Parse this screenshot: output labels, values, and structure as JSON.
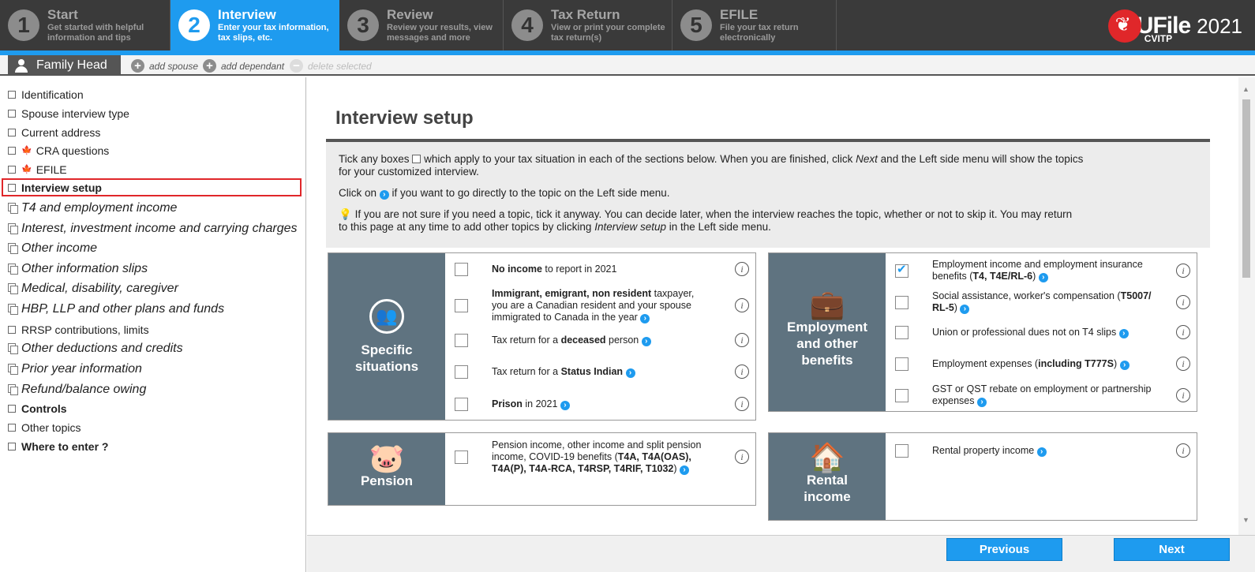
{
  "steps": [
    {
      "num": "1",
      "title": "Start",
      "sub1": "Get started with helpful",
      "sub2": "information and tips"
    },
    {
      "num": "2",
      "title": "Interview",
      "sub1": "Enter your tax information,",
      "sub2": "tax slips, etc."
    },
    {
      "num": "3",
      "title": "Review",
      "sub1": "Review your results, view",
      "sub2": "messages and more"
    },
    {
      "num": "4",
      "title": "Tax Return",
      "sub1": "View or print your complete",
      "sub2": "tax return(s)"
    },
    {
      "num": "5",
      "title": "EFILE",
      "sub1": "File your tax return",
      "sub2": "electronically"
    }
  ],
  "logo": {
    "brand": "UFile",
    "sub": "CVITP",
    "year": "2021"
  },
  "family": {
    "tab": "Family Head",
    "add_spouse": "add spouse",
    "add_dependant": "add dependant",
    "delete_selected": "delete selected"
  },
  "sidebar": [
    "Identification",
    "Spouse interview type",
    "Current address",
    "CRA questions",
    "EFILE",
    "Interview setup",
    "T4 and employment income",
    "Interest, investment income and carrying charges",
    "Other income",
    "Other information slips",
    "Medical, disability, caregiver",
    "HBP, LLP and other plans and funds",
    "RRSP contributions, limits",
    "Other deductions and credits",
    "Prior year information",
    "Refund/balance owing",
    "Controls",
    "Other topics",
    "Where to enter ?"
  ],
  "main": {
    "title": "Interview setup",
    "intro": {
      "p1a": "Tick any boxes",
      "p1b": "which apply to your tax situation in each of the sections below. When you are finished, click",
      "p1c": "Next",
      "p1d": "and the Left side menu will show the topics",
      "p1e": "for your customized interview.",
      "p2a": "Click on",
      "p2b": "if you want to go directly to the topic on the Left side menu.",
      "p3a": "If you are not sure if you need a topic, tick it anyway. You can decide later, when the interview reaches the topic, whether or not to skip it. You may return",
      "p3b": "to this page at any time to add other topics by clicking",
      "p3c": "Interview setup",
      "p3d": "in the Left side menu."
    },
    "specific": {
      "title1": "Specific",
      "title2": "situations",
      "r1b": "No income",
      "r1": "to report in 2021",
      "r2b": "Immigrant, emigrant, non resident",
      "r2a": "taxpayer,",
      "r2c": "you are a Canadian resident and your spouse",
      "r2d": "immigrated to Canada in the year",
      "r3a": "Tax return for a",
      "r3b": "deceased",
      "r3c": "person",
      "r4a": "Tax return for a",
      "r4b": "Status Indian",
      "r5b": "Prison",
      "r5": "in 2021"
    },
    "employment": {
      "title1": "Employment",
      "title2": "and other",
      "title3": "benefits",
      "r1a": "Employment income and employment insurance",
      "r1b": "benefits (",
      "r1c": "T4, T4E/RL-6",
      "r1d": ")",
      "r2a": "Social assistance, worker's compensation (",
      "r2b": "T5007/",
      "r2c": "RL-5",
      "r2d": ")",
      "r3": "Union or professional dues not on T4 slips",
      "r4a": "Employment expenses (",
      "r4b": "including T777S",
      "r4c": ")",
      "r5a": "GST or QST rebate on employment or partnership",
      "r5b": "expenses"
    },
    "pension": {
      "title": "Pension",
      "r1a": "Pension income, other income and split pension",
      "r1b": "income, COVID-19 benefits (",
      "r1c": "T4A, T4A(OAS),",
      "r1d": "T4A(P), T4A-RCA, T4RSP, T4RIF, T1032",
      "r1e": ")"
    },
    "rental": {
      "title1": "Rental",
      "title2": "income",
      "r1": "Rental property income"
    }
  },
  "footer": {
    "previous": "Previous",
    "next": "Next"
  },
  "colors": {
    "accent": "#1e9bef",
    "card_side": "#5f7380",
    "selected_border": "#e0272a"
  }
}
